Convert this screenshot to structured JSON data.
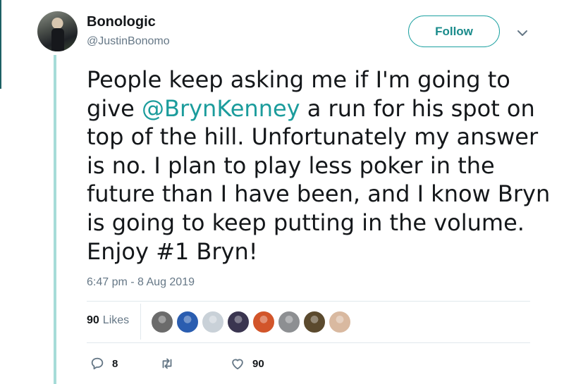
{
  "user": {
    "display_name": "Bonologic",
    "handle": "@JustinBonomo"
  },
  "follow_label": "Follow",
  "tweet": {
    "text_before": "People keep asking me if I'm going to give ",
    "mention": "@BrynKenney",
    "text_after": " a run for his spot on top of the hill. Unfortunately my answer is no. I plan to play less poker in the future than I have been, and I know Bryn is going to keep putting in the volume. Enjoy #1 Bryn!",
    "timestamp": "6:47 pm - 8 Aug 2019"
  },
  "stats": {
    "likes_count": "90",
    "likes_label": "Likes"
  },
  "actions": {
    "reply_count": "8",
    "retweet_count": "",
    "like_count": "90"
  },
  "colors": {
    "accent": "#1da1a1",
    "mention": "#1b9c9c",
    "thread_line": "#a6dcd8",
    "secondary_text": "#657786"
  },
  "likers": [
    {
      "name": "liker-avatar-1",
      "color": "#6b6b6b"
    },
    {
      "name": "liker-avatar-2",
      "color": "#2a5db0"
    },
    {
      "name": "liker-avatar-3",
      "color": "#c9d1d8"
    },
    {
      "name": "liker-avatar-4",
      "color": "#3a3550"
    },
    {
      "name": "liker-avatar-5",
      "color": "#d2552a"
    },
    {
      "name": "liker-avatar-6",
      "color": "#8d8f92"
    },
    {
      "name": "liker-avatar-7",
      "color": "#5b4a2e"
    },
    {
      "name": "liker-avatar-8",
      "color": "#d9b9a0"
    }
  ]
}
